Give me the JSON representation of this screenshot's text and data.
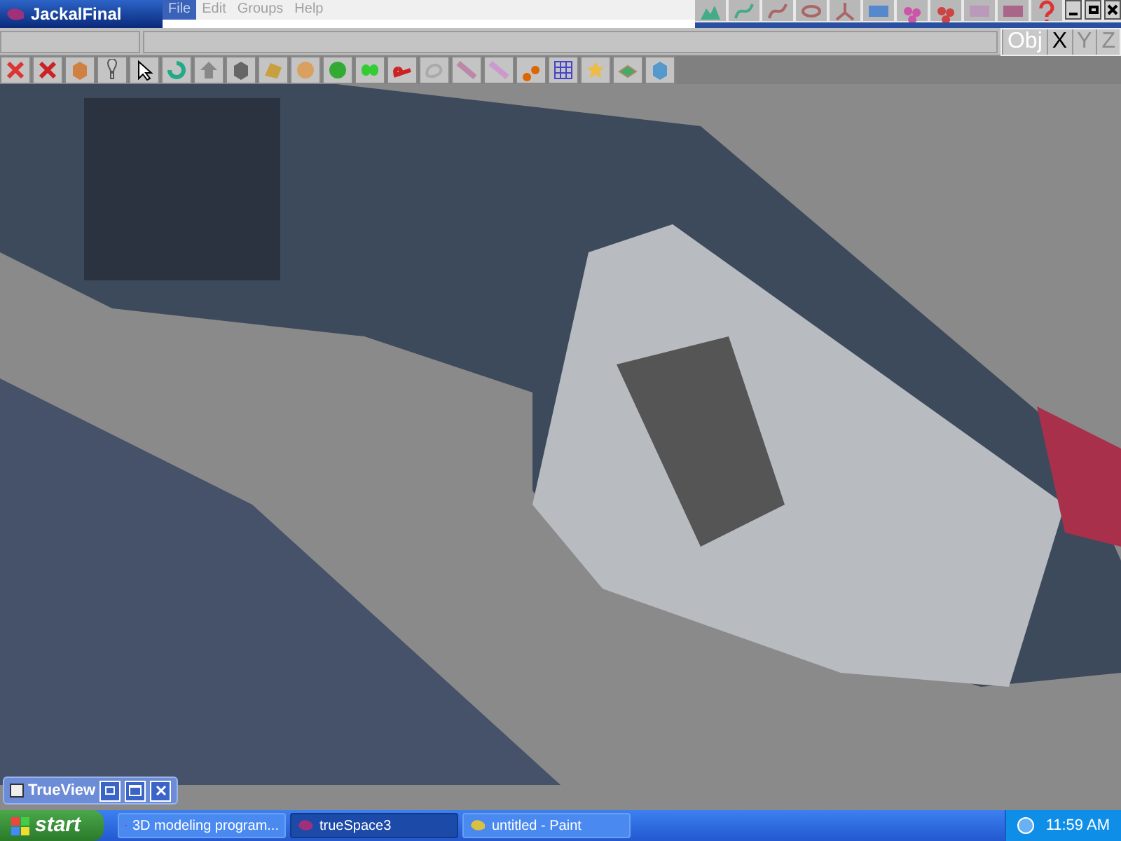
{
  "window": {
    "title": "JackalFinal"
  },
  "menu": [
    {
      "label": "File",
      "selected": true
    },
    {
      "label": "Edit",
      "selected": false
    },
    {
      "label": "Groups",
      "selected": false
    },
    {
      "label": "Help",
      "selected": false
    }
  ],
  "axes": [
    {
      "label": "Obj",
      "selected": false
    },
    {
      "label": "X",
      "selected": true
    },
    {
      "label": "Y",
      "selected": false
    },
    {
      "label": "Z",
      "selected": false
    }
  ],
  "trueview": {
    "title": "TrueView"
  },
  "taskbar": {
    "start": "start",
    "items": [
      {
        "label": "3D modeling program...",
        "selected": false
      },
      {
        "label": "trueSpace3",
        "selected": true
      },
      {
        "label": "untitled - Paint",
        "selected": false
      }
    ],
    "clock": "11:59 AM"
  }
}
